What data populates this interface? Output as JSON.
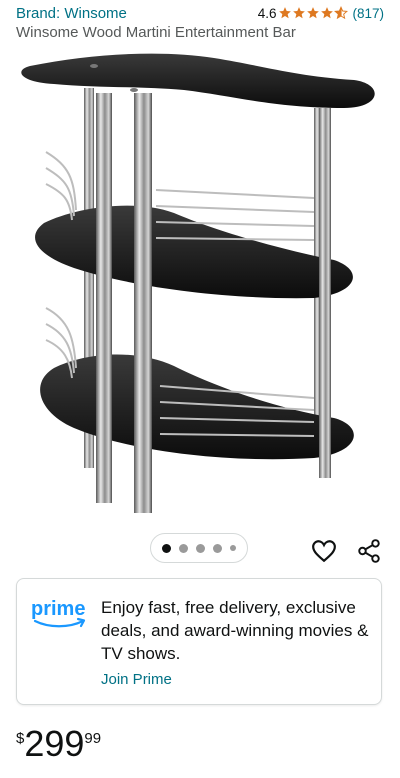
{
  "header": {
    "brand": "Brand: Winsome",
    "rating": "4.6",
    "star_rating": 4.6,
    "review_count": "(817)"
  },
  "product": {
    "title": "Winsome Wood Martini Entertainment Bar"
  },
  "carousel": {
    "total": 5,
    "active_index": 0
  },
  "prime": {
    "logo_text": "prime",
    "promo": "Enjoy fast, free delivery, exclusive deals, and award-winning movies & TV shows.",
    "cta": "Join Prime"
  },
  "price": {
    "symbol": "$",
    "whole": "299",
    "fraction": "99"
  },
  "colors": {
    "link": "#007185",
    "star": "#DE7921",
    "prime_blue": "#1A98FF",
    "text": "#0F1111",
    "secondary_text": "#565959"
  },
  "icons": {
    "wishlist": "heart-icon",
    "share": "share-icon"
  }
}
